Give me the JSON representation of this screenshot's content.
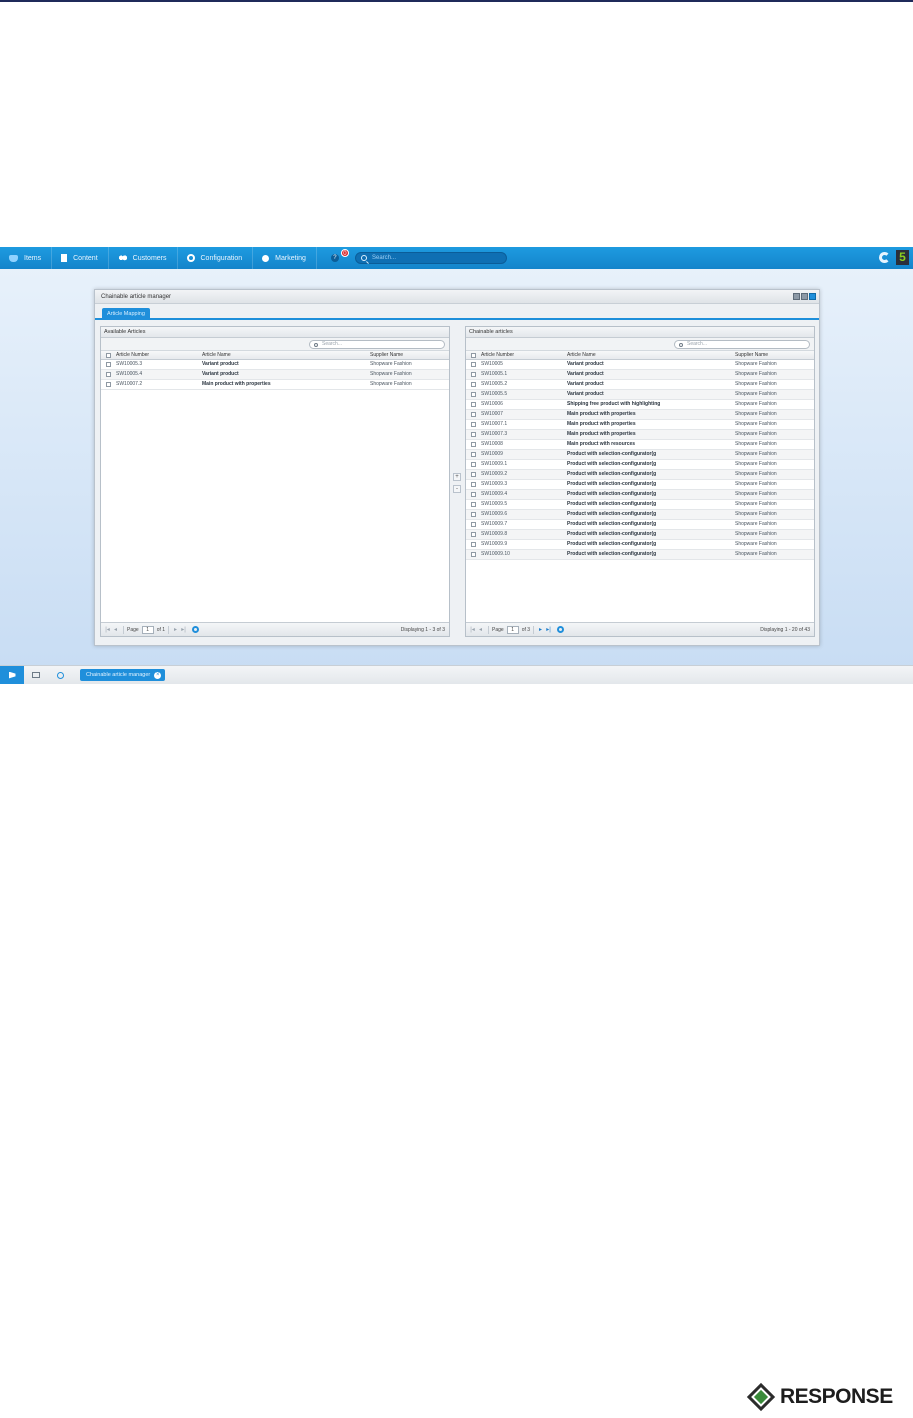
{
  "menu": {
    "items": [
      {
        "label": "Items",
        "icon": "items-icon"
      },
      {
        "label": "Content",
        "icon": "content-icon"
      },
      {
        "label": "Customers",
        "icon": "customers-icon"
      },
      {
        "label": "Configuration",
        "icon": "configuration-icon"
      },
      {
        "label": "Marketing",
        "icon": "marketing-icon"
      }
    ],
    "help_badge": "0",
    "search_placeholder": "Search...",
    "logo_text": "5"
  },
  "window": {
    "title": "Chainable article manager",
    "tab": "Article Mapping"
  },
  "left_panel": {
    "title": "Available Articles",
    "search_placeholder": "Search...",
    "columns": [
      "Article Number",
      "Article Name",
      "Supplier Name"
    ],
    "rows": [
      [
        "SW10005.3",
        "Variant product",
        "Shopware Fashion"
      ],
      [
        "SW10005.4",
        "Variant product",
        "Shopware Fashion"
      ],
      [
        "SW10007.2",
        "Main product with properties",
        "Shopware Fashion"
      ]
    ],
    "pager": {
      "page_label": "Page",
      "page": "1",
      "of": "of 1",
      "display": "Displaying 1 - 3 of 3"
    }
  },
  "right_panel": {
    "title": "Chainable articles",
    "search_placeholder": "Search...",
    "columns": [
      "Article Number",
      "Article Name",
      "Supplier Name"
    ],
    "rows": [
      [
        "SW10005",
        "Variant product",
        "Shopware Fashion"
      ],
      [
        "SW10005.1",
        "Variant product",
        "Shopware Fashion"
      ],
      [
        "SW10005.2",
        "Variant product",
        "Shopware Fashion"
      ],
      [
        "SW10005.5",
        "Variant product",
        "Shopware Fashion"
      ],
      [
        "SW10006",
        "Shipping free product with highlighting",
        "Shopware Fashion"
      ],
      [
        "SW10007",
        "Main product with properties",
        "Shopware Fashion"
      ],
      [
        "SW10007.1",
        "Main product with properties",
        "Shopware Fashion"
      ],
      [
        "SW10007.3",
        "Main product with properties",
        "Shopware Fashion"
      ],
      [
        "SW10008",
        "Main product with resources",
        "Shopware Fashion"
      ],
      [
        "SW10009",
        "Product with selection-configurator(g",
        "Shopware Fashion"
      ],
      [
        "SW10009.1",
        "Product with selection-configurator(g",
        "Shopware Fashion"
      ],
      [
        "SW10009.2",
        "Product with selection-configurator(g",
        "Shopware Fashion"
      ],
      [
        "SW10009.3",
        "Product with selection-configurator(g",
        "Shopware Fashion"
      ],
      [
        "SW10009.4",
        "Product with selection-configurator(g",
        "Shopware Fashion"
      ],
      [
        "SW10009.5",
        "Product with selection-configurator(g",
        "Shopware Fashion"
      ],
      [
        "SW10009.6",
        "Product with selection-configurator(g",
        "Shopware Fashion"
      ],
      [
        "SW10009.7",
        "Product with selection-configurator(g",
        "Shopware Fashion"
      ],
      [
        "SW10009.8",
        "Product with selection-configurator(g",
        "Shopware Fashion"
      ],
      [
        "SW10009.9",
        "Product with selection-configurator(g",
        "Shopware Fashion"
      ],
      [
        "SW10009.10",
        "Product with selection-configurator(g",
        "Shopware Fashion"
      ]
    ],
    "pager": {
      "page_label": "Page",
      "page": "1",
      "of": "of 3",
      "display": "Displaying 1 - 20 of 43"
    }
  },
  "move": {
    "add": "+",
    "remove": "-"
  },
  "taskbar": {
    "task": "Chainable article manager"
  },
  "brand": {
    "name": "RESPONSE"
  },
  "colors": {
    "accent": "#1f8fdb",
    "menubar": "#1484cb",
    "badge": "#d9262b"
  }
}
